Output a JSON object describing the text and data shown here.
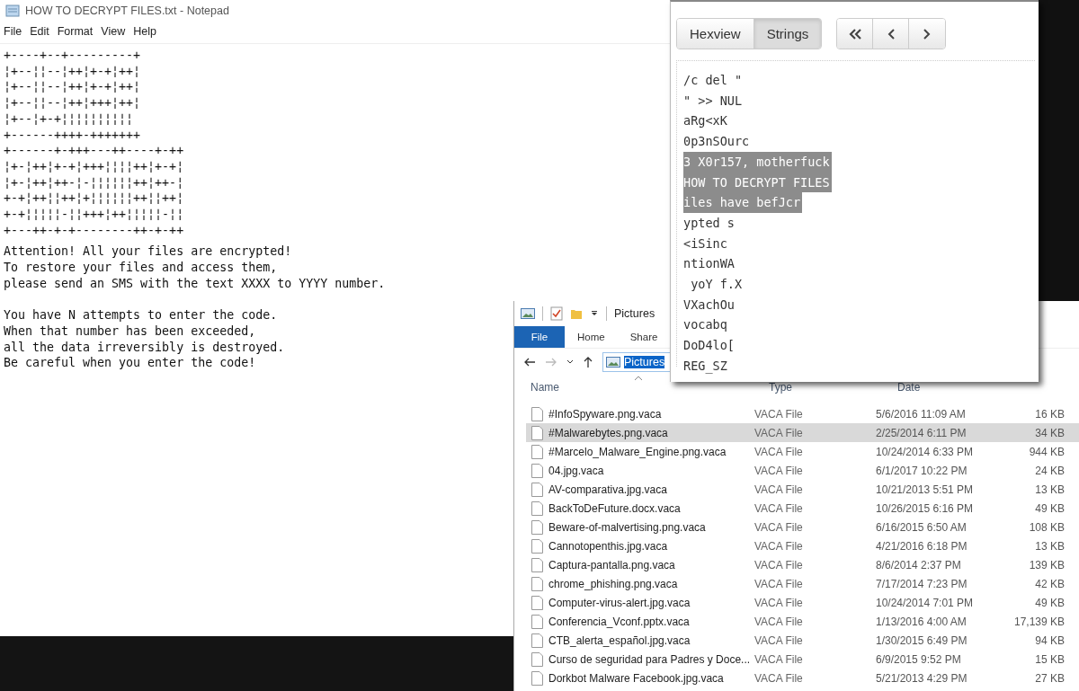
{
  "notepad": {
    "title": "HOW TO DECRYPT FILES.txt - Notepad",
    "menu": [
      "File",
      "Edit",
      "Format",
      "View",
      "Help"
    ],
    "ascii_art": [
      "+----+--+---------+",
      "¦+--¦¦--¦++¦+-+¦++¦",
      "¦+--¦¦--¦++¦+-+¦++¦",
      "¦+--¦¦--¦++¦+++¦++¦",
      "¦+--¦+-+¦¦¦¦¦¦¦¦¦¦",
      "+------++++-+++++++",
      "+------+-+++---++----+-++",
      "¦+-¦++¦+-+¦+++¦¦¦¦++¦+-+¦",
      "¦+-¦++¦++-¦-¦¦¦¦¦¦++¦++-¦",
      "+-+¦++¦¦++¦+¦¦¦¦¦¦++¦¦++¦",
      "+-+¦¦¦¦¦-¦¦+++¦++¦¦¦¦¦-¦¦",
      "+---++-+-+--------++-+-++"
    ],
    "paragraphs": [
      [
        "Attention! All your files are encrypted!",
        "To restore your files and access them,",
        "please send an SMS with the text XXXX to YYYY number."
      ],
      [
        "You have N attempts to enter the code.",
        "When that number has been exceeded,",
        "all the data irreversibly is destroyed.",
        "Be careful when you enter the code!"
      ]
    ]
  },
  "hex_viewer": {
    "view_tabs": [
      {
        "label": "Hexview",
        "selected": false
      },
      {
        "label": "Strings",
        "selected": true
      }
    ],
    "strings": [
      {
        "text": "/c del \"",
        "selected": false
      },
      {
        "text": "\" >> NUL",
        "selected": false
      },
      {
        "text": "aRg<xK",
        "selected": false
      },
      {
        "text": "0p3nSOurc",
        "selected": false
      },
      {
        "text": "3 X0r157, motherfuck",
        "selected": true
      },
      {
        "text": "HOW TO DECRYPT FILES",
        "selected": true
      },
      {
        "text": "iles have befJcr",
        "selected": true
      },
      {
        "text": "ypted s",
        "selected": false
      },
      {
        "text": "<iSinc",
        "selected": false
      },
      {
        "text": "ntionWA",
        "selected": false
      },
      {
        "text": " yoY f.X",
        "selected": false
      },
      {
        "text": "VXachOu",
        "selected": false
      },
      {
        "text": "vocabq",
        "selected": false
      },
      {
        "text": "DoD4lo[",
        "selected": false
      },
      {
        "text": "REG_SZ",
        "selected": false
      }
    ]
  },
  "explorer": {
    "title": "Pictures",
    "ribbon_tabs": [
      {
        "label": "File",
        "selected": true
      },
      {
        "label": "Home",
        "selected": false
      },
      {
        "label": "Share",
        "selected": false
      }
    ],
    "address": "Pictures",
    "columns": [
      "Name",
      "Type",
      "Date"
    ],
    "rows": [
      {
        "name": "#InfoSpyware.png.vaca",
        "type": "VACA File",
        "date": "5/6/2016 11:09 AM",
        "size": "16 KB",
        "selected": false
      },
      {
        "name": "#Malwarebytes.png.vaca",
        "type": "VACA File",
        "date": "2/25/2014 6:11 PM",
        "size": "34 KB",
        "selected": true
      },
      {
        "name": "#Marcelo_Malware_Engine.png.vaca",
        "type": "VACA File",
        "date": "10/24/2014 6:33 PM",
        "size": "944 KB",
        "selected": false
      },
      {
        "name": "04.jpg.vaca",
        "type": "VACA File",
        "date": "6/1/2017 10:22 PM",
        "size": "24 KB",
        "selected": false
      },
      {
        "name": "AV-comparativa.jpg.vaca",
        "type": "VACA File",
        "date": "10/21/2013 5:51 PM",
        "size": "13 KB",
        "selected": false
      },
      {
        "name": "BackToDeFuture.docx.vaca",
        "type": "VACA File",
        "date": "10/26/2015 6:16 PM",
        "size": "49 KB",
        "selected": false
      },
      {
        "name": "Beware-of-malvertising.png.vaca",
        "type": "VACA File",
        "date": "6/16/2015 6:50 AM",
        "size": "108 KB",
        "selected": false
      },
      {
        "name": "Cannotopenthis.jpg.vaca",
        "type": "VACA File",
        "date": "4/21/2016 6:18 PM",
        "size": "13 KB",
        "selected": false
      },
      {
        "name": "Captura-pantalla.png.vaca",
        "type": "VACA File",
        "date": "8/6/2014 2:37 PM",
        "size": "139 KB",
        "selected": false
      },
      {
        "name": "chrome_phishing.png.vaca",
        "type": "VACA File",
        "date": "7/17/2014 7:23 PM",
        "size": "42 KB",
        "selected": false
      },
      {
        "name": "Computer-virus-alert.jpg.vaca",
        "type": "VACA File",
        "date": "10/24/2014 7:01 PM",
        "size": "49 KB",
        "selected": false
      },
      {
        "name": "Conferencia_Vconf.pptx.vaca",
        "type": "VACA File",
        "date": "1/13/2016 4:00 AM",
        "size": "17,139 KB",
        "selected": false
      },
      {
        "name": "CTB_alerta_español.jpg.vaca",
        "type": "VACA File",
        "date": "1/30/2015 6:49 PM",
        "size": "94 KB",
        "selected": false
      },
      {
        "name": "Curso de seguridad para Padres y Doce...",
        "type": "VACA File",
        "date": "6/9/2015 9:52 PM",
        "size": "15 KB",
        "selected": false
      },
      {
        "name": "Dorkbot Malware Facebook.jpg.vaca",
        "type": "VACA File",
        "date": "5/21/2013 4:29 PM",
        "size": "27 KB",
        "selected": false
      }
    ]
  }
}
